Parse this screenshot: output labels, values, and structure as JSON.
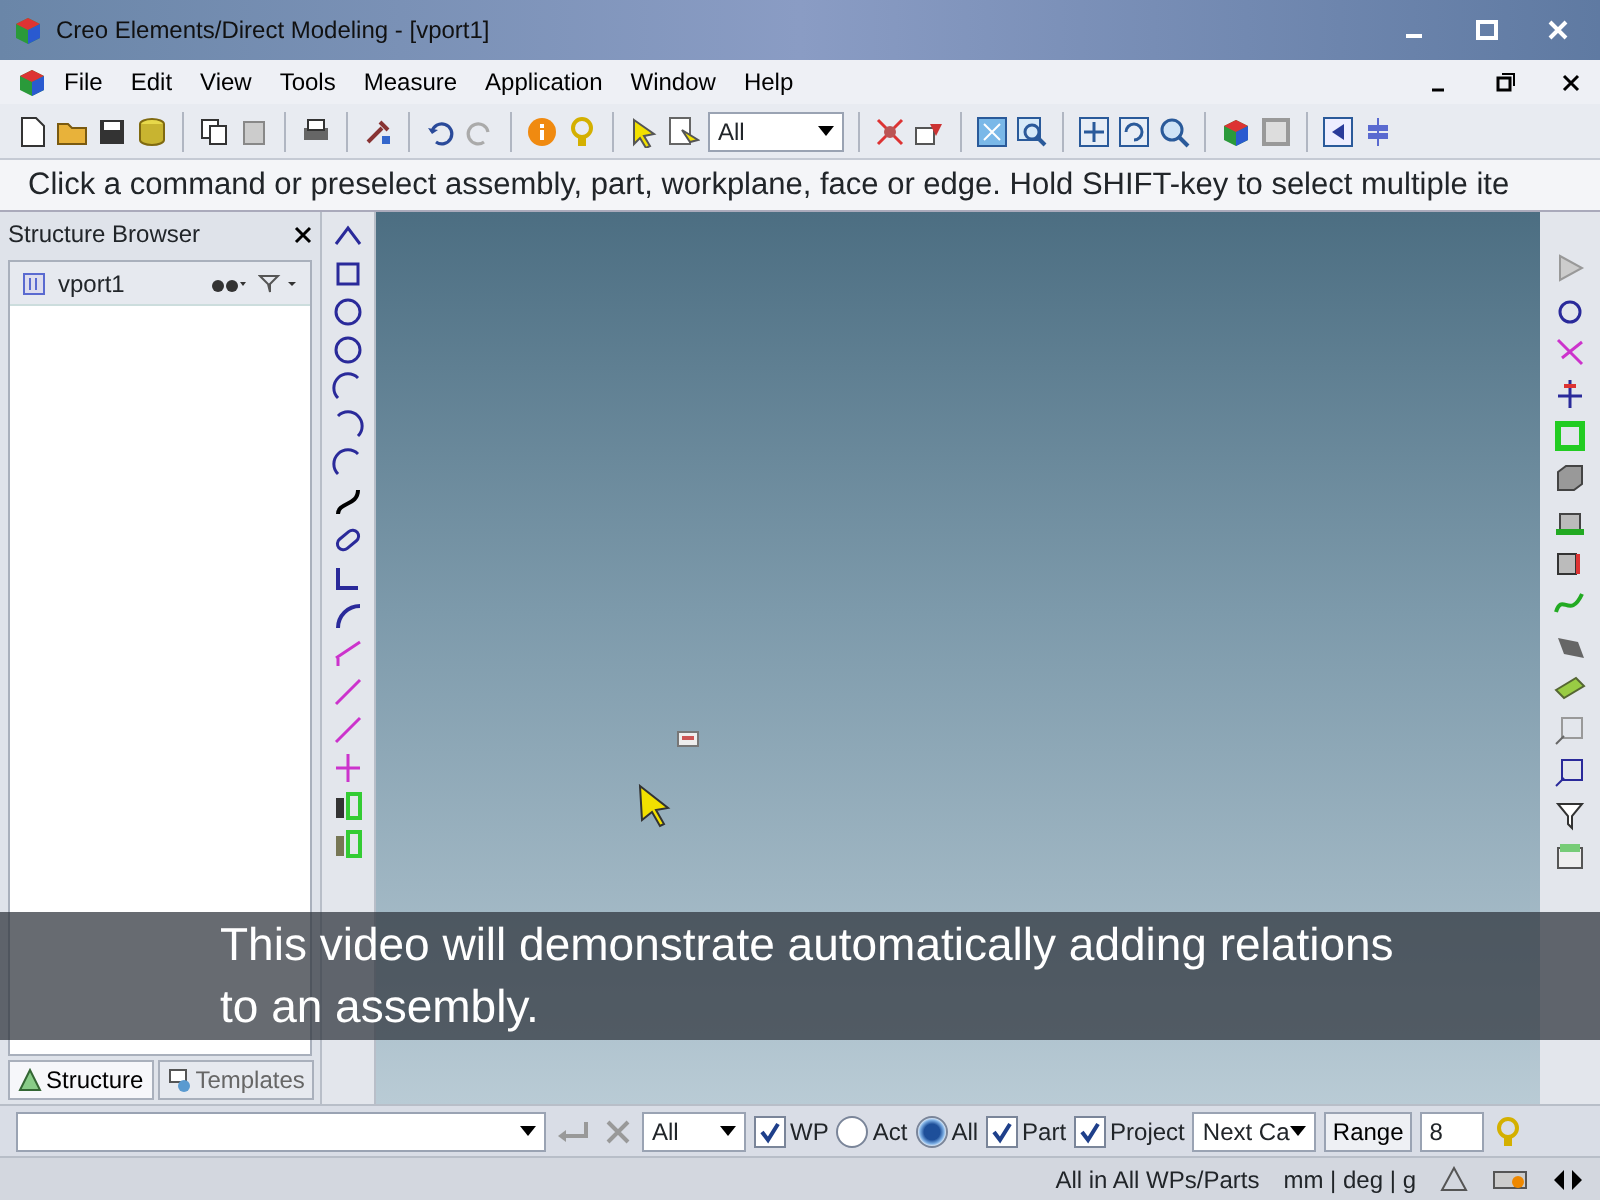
{
  "window": {
    "title": "Creo Elements/Direct Modeling - [vport1]"
  },
  "menu": [
    "File",
    "Edit",
    "View",
    "Tools",
    "Measure",
    "Application",
    "Window",
    "Help"
  ],
  "toolbar": {
    "filter": "All"
  },
  "prompt": "Click a command or preselect assembly, part, workplane, face or edge. Hold SHIFT-key to select multiple ite",
  "structure_browser": {
    "title": "Structure Browser",
    "root": "vport1",
    "tabs": [
      {
        "label": "Structure",
        "selected": true
      },
      {
        "label": "Templates",
        "selected": false
      }
    ]
  },
  "selection_bar": {
    "filter": "All",
    "options": [
      {
        "kind": "check",
        "label": "WP",
        "checked": true
      },
      {
        "kind": "radio",
        "label": "Act",
        "selected": false
      },
      {
        "kind": "radio",
        "label": "All",
        "selected": true
      },
      {
        "kind": "check",
        "label": "Part",
        "checked": true
      },
      {
        "kind": "check",
        "label": "Project",
        "checked": true
      }
    ],
    "next": "Next Ca",
    "range_button": "Range",
    "range_value": "8"
  },
  "status_bar": {
    "scope": "All in All WPs/Parts",
    "units": "mm | deg | g"
  },
  "caption": "This video will demonstrate automatically adding relations to an assembly."
}
